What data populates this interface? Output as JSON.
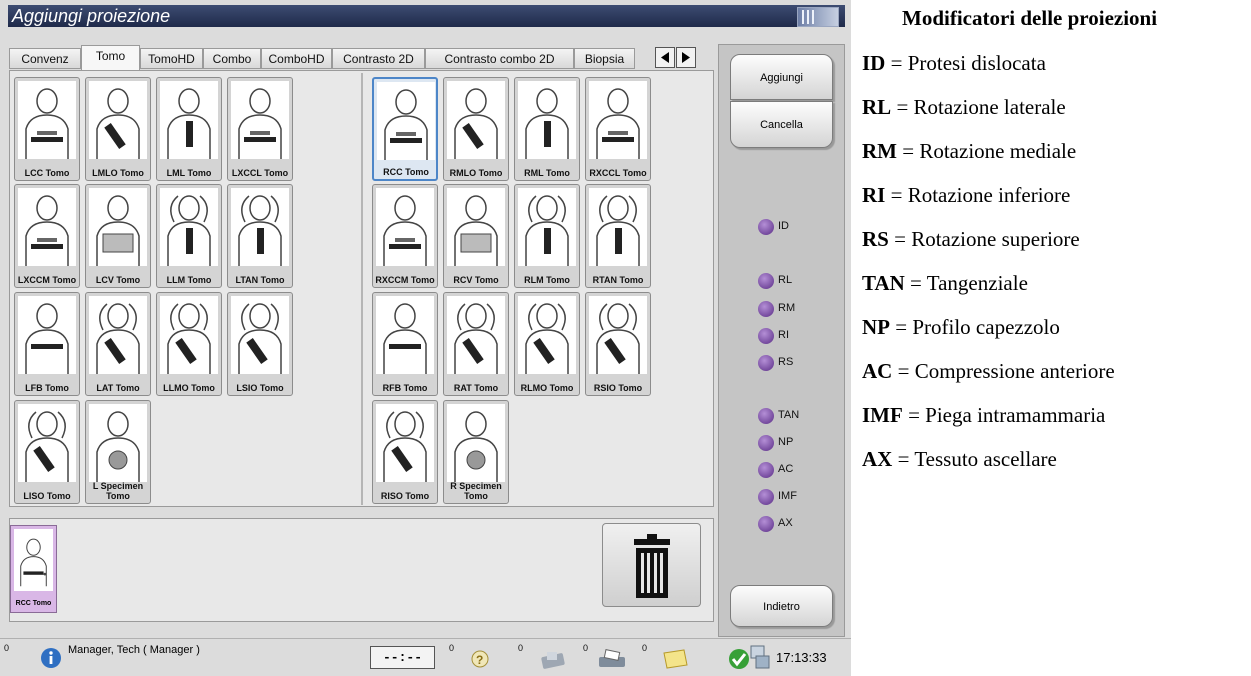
{
  "window": {
    "title": "Aggiungi proiezione"
  },
  "tabs": [
    "Convenz",
    "Tomo",
    "TomoHD",
    "Combo",
    "ComboHD",
    "Contrasto 2D",
    "Contrasto combo 2D",
    "Biopsia"
  ],
  "active_tab": "Tomo",
  "views_left": [
    {
      "label": "LCC Tomo",
      "icon": "cc-view-icon"
    },
    {
      "label": "LMLO Tomo",
      "icon": "mlo-view-icon"
    },
    {
      "label": "LML Tomo",
      "icon": "ml-view-icon"
    },
    {
      "label": "LXCCL Tomo",
      "icon": "xccl-view-icon"
    },
    {
      "label": "LXCCM Tomo",
      "icon": "xccm-view-icon"
    },
    {
      "label": "LCV Tomo",
      "icon": "cv-view-icon"
    },
    {
      "label": "LLM Tomo",
      "icon": "lm-view-icon"
    },
    {
      "label": "LTAN Tomo",
      "icon": "tan-view-icon"
    },
    {
      "label": "LFB Tomo",
      "icon": "fb-view-icon"
    },
    {
      "label": "LAT Tomo",
      "icon": "at-view-icon"
    },
    {
      "label": "LLMO Tomo",
      "icon": "lmo-view-icon"
    },
    {
      "label": "LSIO Tomo",
      "icon": "sio-view-icon"
    },
    {
      "label": "LISO Tomo",
      "icon": "iso-view-icon"
    },
    {
      "label": "L Specimen Tomo",
      "icon": "specimen-view-icon"
    }
  ],
  "views_right": [
    {
      "label": "RCC Tomo",
      "icon": "cc-view-icon",
      "selected": true
    },
    {
      "label": "RMLO Tomo",
      "icon": "mlo-view-icon"
    },
    {
      "label": "RML Tomo",
      "icon": "ml-view-icon"
    },
    {
      "label": "RXCCL Tomo",
      "icon": "xccl-view-icon"
    },
    {
      "label": "RXCCM Tomo",
      "icon": "xccm-view-icon"
    },
    {
      "label": "RCV Tomo",
      "icon": "cv-view-icon"
    },
    {
      "label": "RLM Tomo",
      "icon": "lm-view-icon"
    },
    {
      "label": "RTAN Tomo",
      "icon": "tan-view-icon"
    },
    {
      "label": "RFB Tomo",
      "icon": "fb-view-icon"
    },
    {
      "label": "RAT Tomo",
      "icon": "at-view-icon"
    },
    {
      "label": "RLMO Tomo",
      "icon": "lmo-view-icon"
    },
    {
      "label": "RSIO Tomo",
      "icon": "sio-view-icon"
    },
    {
      "label": "RISO Tomo",
      "icon": "iso-view-icon"
    },
    {
      "label": "R Specimen Tomo",
      "icon": "specimen-view-icon"
    }
  ],
  "tray": {
    "item_label": "RCC Tomo"
  },
  "buttons": {
    "add": "Aggiungi",
    "clear": "Cancella",
    "back": "Indietro"
  },
  "modifiers": [
    "ID",
    "RL",
    "RM",
    "RI",
    "RS",
    "TAN",
    "NP",
    "AC",
    "IMF",
    "AX"
  ],
  "status": {
    "counts": [
      "0",
      "0",
      "0",
      "0",
      "0"
    ],
    "user": "Manager, Tech ( Manager )",
    "timer": "--:--",
    "clock": "17:13:33"
  },
  "legend": {
    "title": "Modificatori delle proiezioni",
    "items": [
      {
        "code": "ID",
        "desc": "Protesi dislocata"
      },
      {
        "code": "RL",
        "desc": "Rotazione laterale"
      },
      {
        "code": "RM",
        "desc": "Rotazione mediale"
      },
      {
        "code": "RI",
        "desc": "Rotazione inferiore"
      },
      {
        "code": "RS",
        "desc": "Rotazione superiore"
      },
      {
        "code": "TAN",
        "desc": "Tangenziale"
      },
      {
        "code": "NP",
        "desc": "Profilo capezzolo"
      },
      {
        "code": "AC",
        "desc": "Compressione anteriore"
      },
      {
        "code": "IMF",
        "desc": "Piega intramammaria"
      },
      {
        "code": "AX",
        "desc": "Tessuto ascellare"
      }
    ]
  },
  "colors": {
    "titlebar": "#2b3760",
    "selected_tray": "#d9b7e6",
    "radio": "#7a48a8",
    "selected_border": "#4d86c8"
  }
}
